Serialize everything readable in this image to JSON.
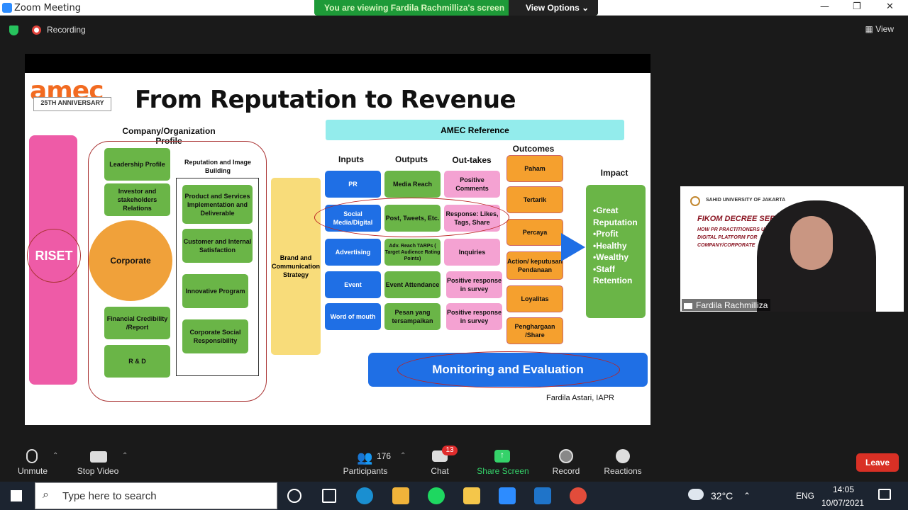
{
  "window": {
    "title": "Zoom Meeting",
    "minimize": "—",
    "restore": "❐",
    "close": "✕"
  },
  "share_banner": {
    "viewing": "You are viewing Fardila Rachmilliza's screen",
    "view_options": "View Options ⌄"
  },
  "recording": {
    "label": "Recording",
    "view_label": "View"
  },
  "slide": {
    "logo": "amec",
    "logo_sub": "25TH ANNIVERSARY",
    "title": "From Reputation to Revenue",
    "company_header": "Company/Organization Profile",
    "amec_reference": "AMEC Reference",
    "riset": "RISET",
    "corporate": "Corporate",
    "left_boxes": [
      "Leadership Profile",
      "Investor and stakeholders Relations",
      "Financial Credibility /Report",
      "R & D"
    ],
    "rep_header": "Reputation and Image Building",
    "rep_boxes": [
      "Product and Services Implementation and Deliverable",
      "Customer and Internal Satisfaction",
      "Innovative Program",
      "Corporate Social Responsibility"
    ],
    "brand": "Brand and Communication Strategy",
    "col_headers": {
      "inputs": "Inputs",
      "outputs": "Outputs",
      "outtakes": "Out-takes",
      "outcomes": "Outcomes",
      "impact": "Impact"
    },
    "inputs": [
      "PR",
      "Social Media/Digital",
      "Advertising",
      "Event",
      "Word of mouth"
    ],
    "outputs": [
      "Media Reach",
      "Post, Tweets, Etc.",
      "Adv. Reach TARPs ( Target Audience Rating Points)",
      "Event Attendance",
      "Pesan yang tersampaikan"
    ],
    "outtakes": [
      "Positive Comments",
      "Response: Likes, Tags, Share",
      "Inquiries",
      "Positive response in survey",
      "Positive response in survey"
    ],
    "outcomes": [
      "Paham",
      "Tertarik",
      "Percaya",
      "Action/ keputusan Pendanaan",
      "Loyalitas",
      "Penghargaan /Share"
    ],
    "impact": [
      "•Great",
      "Reputation",
      "•Profit",
      "•Healthy",
      "•Wealthy",
      "•Staff",
      "Retention"
    ],
    "monitoring": "Monitoring and Evaluation",
    "author": "Fardila Astari, IAPR"
  },
  "video": {
    "university": "SAHID UNIVERSITY OF JAKARTA",
    "series": "FIKOM DECREE SERIES",
    "subtitle": "HOW PR PRACTITIONERS UTILIZE DIGITAL PLATFORM FOR COMPANY/CORPORATE",
    "name": "Fardila Rachmilliza"
  },
  "toolbar": {
    "unmute": "Unmute",
    "stop_video": "Stop Video",
    "participants": "Participants",
    "participants_count": "176",
    "chat": "Chat",
    "chat_badge": "13",
    "share_screen": "Share Screen",
    "record": "Record",
    "reactions": "Reactions",
    "leave": "Leave"
  },
  "taskbar": {
    "search_placeholder": "Type here to search",
    "temp": "32°C",
    "lang": "ENG",
    "time": "14:05",
    "date": "10/07/2021"
  }
}
